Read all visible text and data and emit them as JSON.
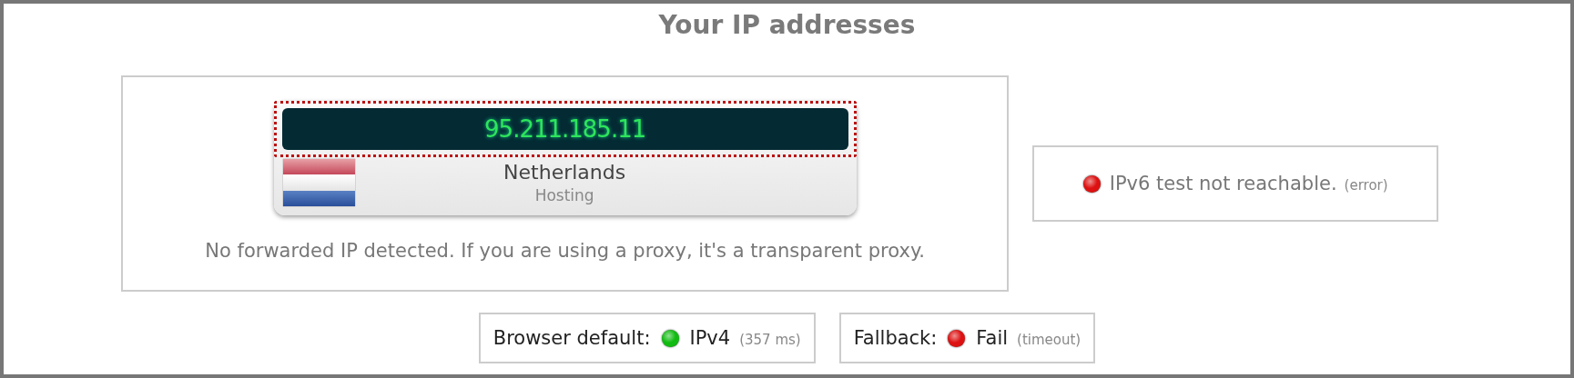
{
  "title": "Your IP addresses",
  "ipv4": {
    "address": "95.211.185.11",
    "country": "Netherlands",
    "type": "Hosting",
    "note": "No forwarded IP detected. If you are using a proxy, it's a transparent proxy."
  },
  "ipv6": {
    "color": "#dd1111",
    "message": "IPv6 test not reachable.",
    "detail": "(error)"
  },
  "checks": [
    {
      "label": "Browser default:",
      "color": "#11bb11",
      "result": "IPv4",
      "detail": "(357 ms)"
    },
    {
      "label": "Fallback:",
      "color": "#dd1111",
      "result": "Fail",
      "detail": "(timeout)"
    }
  ]
}
